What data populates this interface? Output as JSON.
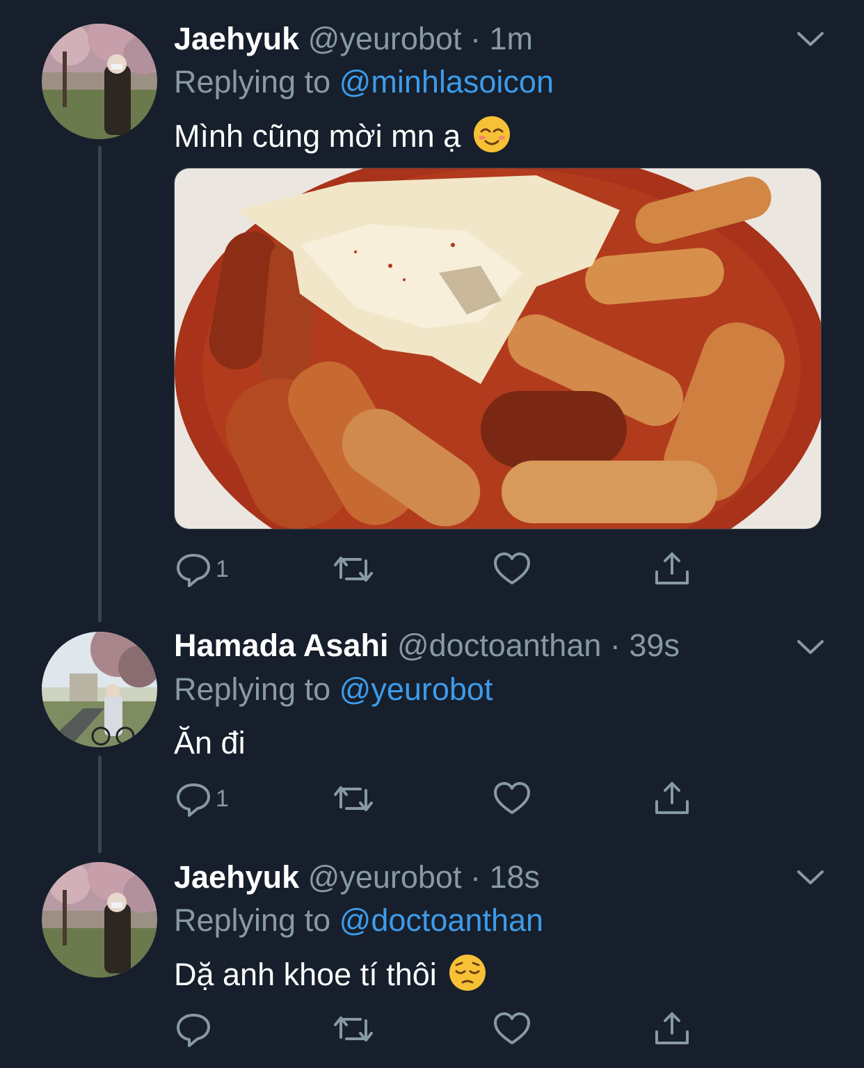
{
  "colors": {
    "background": "#161f2b",
    "secondary_text": "#8899a6",
    "link": "#3d9bea",
    "thread_line": "#3a4450"
  },
  "tweets": [
    {
      "display_name": "Jaehyuk",
      "handle": "@yeurobot",
      "separator": "·",
      "time": "1m",
      "replying_prefix": "Replying to",
      "replying_to": "@minhlasoicon",
      "text": "Mình cũng mời mn ạ",
      "emoji": "smiling-face-icon",
      "has_media": true,
      "media_description": "tteokbokki-photo",
      "reply_count": "1",
      "retweet_count": "",
      "like_count": ""
    },
    {
      "display_name": "Hamada Asahi",
      "handle": "@doctoanthan",
      "separator": "·",
      "time": "39s",
      "replying_prefix": "Replying to",
      "replying_to": "@yeurobot",
      "text": "Ăn đi",
      "emoji": "",
      "has_media": false,
      "reply_count": "1",
      "retweet_count": "",
      "like_count": ""
    },
    {
      "display_name": "Jaehyuk",
      "handle": "@yeurobot",
      "separator": "·",
      "time": "18s",
      "replying_prefix": "Replying to",
      "replying_to": "@doctoanthan",
      "text": "Dặ anh khoe tí thôi",
      "emoji": "pensive-face-icon",
      "has_media": false,
      "reply_count": "",
      "retweet_count": "",
      "like_count": ""
    }
  ]
}
